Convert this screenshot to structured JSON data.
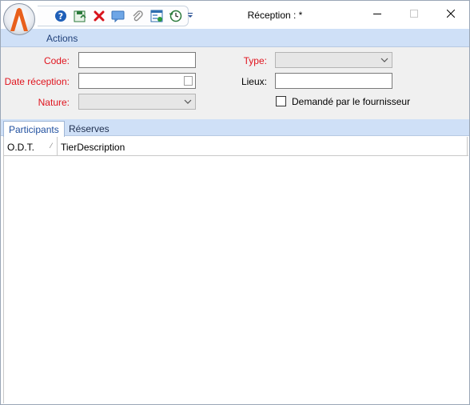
{
  "window": {
    "title": "Réception : *",
    "controls": {
      "minimize": "minimize",
      "maximize": "maximize",
      "close": "close"
    }
  },
  "quick_access": {
    "icons": [
      "help-icon",
      "save-close-icon",
      "delete-icon",
      "comment-icon",
      "attachment-icon",
      "form-add-icon",
      "history-icon"
    ],
    "more_icon": "chevron-down-icon"
  },
  "ribbon": {
    "tab": "Actions"
  },
  "form": {
    "code": {
      "label": "Code:",
      "value": ""
    },
    "date_reception": {
      "label": "Date réception:",
      "value": ""
    },
    "nature": {
      "label": "Nature:",
      "value": ""
    },
    "type": {
      "label": "Type:",
      "value": ""
    },
    "lieux": {
      "label": "Lieux:",
      "value": ""
    },
    "demande_fournisseur": {
      "label": "Demandé par le fournisseur",
      "checked": false
    }
  },
  "tabs": [
    {
      "label": "Participants",
      "active": true
    },
    {
      "label": "Réserves",
      "active": false
    }
  ],
  "grid": {
    "columns": [
      "O.D.T.",
      "TierDescription"
    ],
    "rows": []
  },
  "colors": {
    "ribbon_bg": "#cfe0f7",
    "form_bg": "#f0f0f0",
    "required_label": "#e0141e",
    "accent_text": "#1f3f79"
  }
}
